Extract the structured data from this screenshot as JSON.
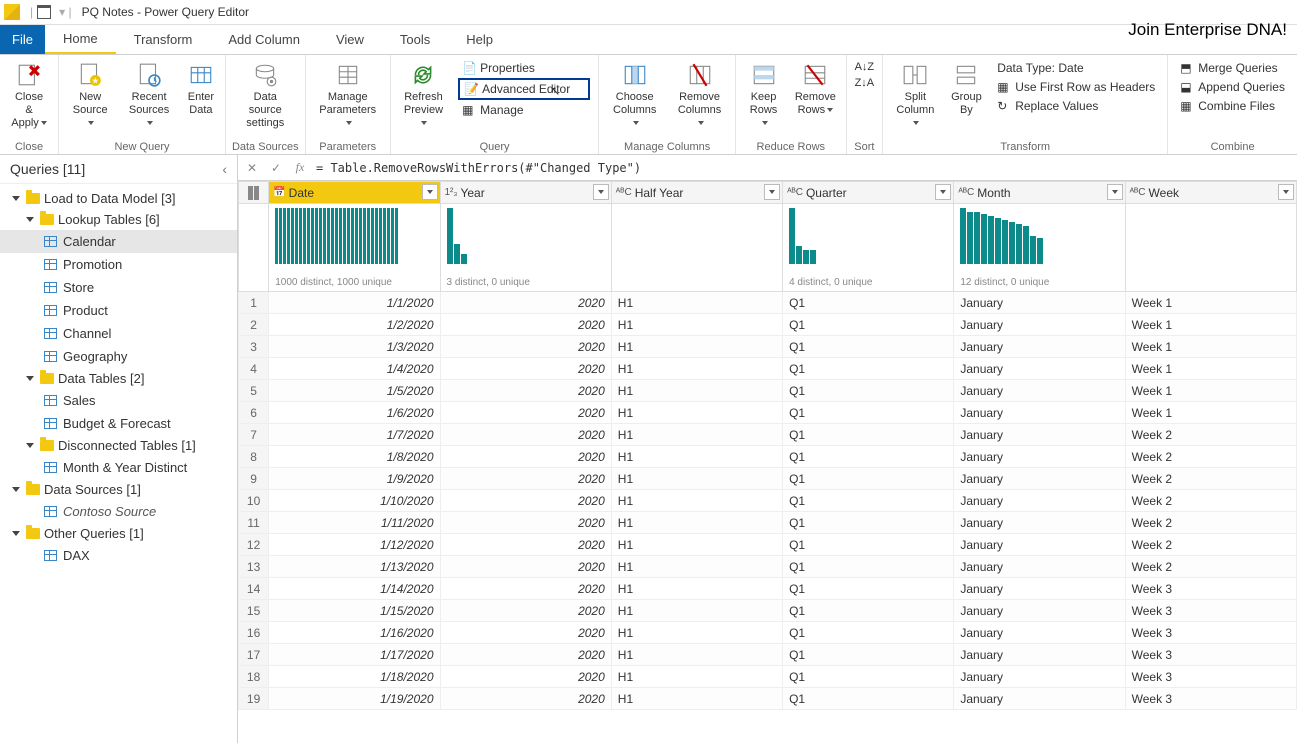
{
  "window": {
    "title": "PQ Notes - Power Query Editor"
  },
  "promo": "Join Enterprise DNA!",
  "tabs": {
    "file": "File",
    "home": "Home",
    "transform": "Transform",
    "add_column": "Add Column",
    "view": "View",
    "tools": "Tools",
    "help": "Help"
  },
  "ribbon": {
    "close_apply": "Close &\nApply",
    "close_group": "Close",
    "new_source": "New\nSource",
    "recent_sources": "Recent\nSources",
    "enter_data": "Enter\nData",
    "new_query_group": "New Query",
    "data_source_settings": "Data source\nsettings",
    "data_sources_group": "Data Sources",
    "manage_parameters": "Manage\nParameters",
    "parameters_group": "Parameters",
    "refresh_preview": "Refresh\nPreview",
    "properties": "Properties",
    "advanced_editor": "Advanced Editor",
    "manage": "Manage",
    "query_group": "Query",
    "choose_columns": "Choose\nColumns",
    "remove_columns": "Remove\nColumns",
    "manage_cols_group": "Manage Columns",
    "keep_rows": "Keep\nRows",
    "remove_rows": "Remove\nRows",
    "reduce_group": "Reduce Rows",
    "sort_group": "Sort",
    "split_column": "Split\nColumn",
    "group_by": "Group\nBy",
    "data_type": "Data Type: Date",
    "use_first_row": "Use First Row as Headers",
    "replace_values": "Replace Values",
    "transform_group": "Transform",
    "merge_queries": "Merge Queries",
    "append_queries": "Append Queries",
    "combine_files": "Combine Files",
    "combine_group": "Combine"
  },
  "sidebar": {
    "header": "Queries [11]",
    "groups": [
      {
        "name": "Load to Data Model [3]",
        "children": [
          {
            "type": "group",
            "name": "Lookup Tables [6]",
            "children": [
              {
                "name": "Calendar",
                "selected": true
              },
              {
                "name": "Promotion"
              },
              {
                "name": "Store"
              },
              {
                "name": "Product"
              },
              {
                "name": "Channel"
              },
              {
                "name": "Geography"
              }
            ]
          },
          {
            "type": "group",
            "name": "Data Tables [2]",
            "children": [
              {
                "name": "Sales"
              },
              {
                "name": "Budget & Forecast"
              }
            ]
          },
          {
            "type": "group",
            "name": "Disconnected Tables [1]",
            "children": [
              {
                "name": "Month & Year Distinct"
              }
            ]
          }
        ]
      },
      {
        "name": "Data Sources [1]",
        "children": [
          {
            "name": "Contoso Source",
            "italic": true
          }
        ]
      },
      {
        "name": "Other Queries [1]",
        "children": [
          {
            "name": "DAX"
          }
        ]
      }
    ]
  },
  "formula": "= Table.RemoveRowsWithErrors(#\"Changed Type\")",
  "columns": [
    {
      "name": "Date",
      "type": "date",
      "profile": "1000 distinct, 1000 unique",
      "bars": 31,
      "selected": true
    },
    {
      "name": "Year",
      "type": "int",
      "profile": "3 distinct, 0 unique",
      "bars": 3
    },
    {
      "name": "Half Year",
      "type": "text",
      "profile": "",
      "bars": 0
    },
    {
      "name": "Quarter",
      "type": "text",
      "profile": "4 distinct, 0 unique",
      "bars": 4
    },
    {
      "name": "Month",
      "type": "text",
      "profile": "12 distinct, 0 unique",
      "bars": 12
    },
    {
      "name": "Week",
      "type": "text",
      "profile": "",
      "bars": 0
    }
  ],
  "rows": [
    [
      "1/1/2020",
      "2020",
      "H1",
      "Q1",
      "January",
      "Week 1"
    ],
    [
      "1/2/2020",
      "2020",
      "H1",
      "Q1",
      "January",
      "Week 1"
    ],
    [
      "1/3/2020",
      "2020",
      "H1",
      "Q1",
      "January",
      "Week 1"
    ],
    [
      "1/4/2020",
      "2020",
      "H1",
      "Q1",
      "January",
      "Week 1"
    ],
    [
      "1/5/2020",
      "2020",
      "H1",
      "Q1",
      "January",
      "Week 1"
    ],
    [
      "1/6/2020",
      "2020",
      "H1",
      "Q1",
      "January",
      "Week 1"
    ],
    [
      "1/7/2020",
      "2020",
      "H1",
      "Q1",
      "January",
      "Week 2"
    ],
    [
      "1/8/2020",
      "2020",
      "H1",
      "Q1",
      "January",
      "Week 2"
    ],
    [
      "1/9/2020",
      "2020",
      "H1",
      "Q1",
      "January",
      "Week 2"
    ],
    [
      "1/10/2020",
      "2020",
      "H1",
      "Q1",
      "January",
      "Week 2"
    ],
    [
      "1/11/2020",
      "2020",
      "H1",
      "Q1",
      "January",
      "Week 2"
    ],
    [
      "1/12/2020",
      "2020",
      "H1",
      "Q1",
      "January",
      "Week 2"
    ],
    [
      "1/13/2020",
      "2020",
      "H1",
      "Q1",
      "January",
      "Week 2"
    ],
    [
      "1/14/2020",
      "2020",
      "H1",
      "Q1",
      "January",
      "Week 3"
    ],
    [
      "1/15/2020",
      "2020",
      "H1",
      "Q1",
      "January",
      "Week 3"
    ],
    [
      "1/16/2020",
      "2020",
      "H1",
      "Q1",
      "January",
      "Week 3"
    ],
    [
      "1/17/2020",
      "2020",
      "H1",
      "Q1",
      "January",
      "Week 3"
    ],
    [
      "1/18/2020",
      "2020",
      "H1",
      "Q1",
      "January",
      "Week 3"
    ],
    [
      "1/19/2020",
      "2020",
      "H1",
      "Q1",
      "January",
      "Week 3"
    ]
  ]
}
